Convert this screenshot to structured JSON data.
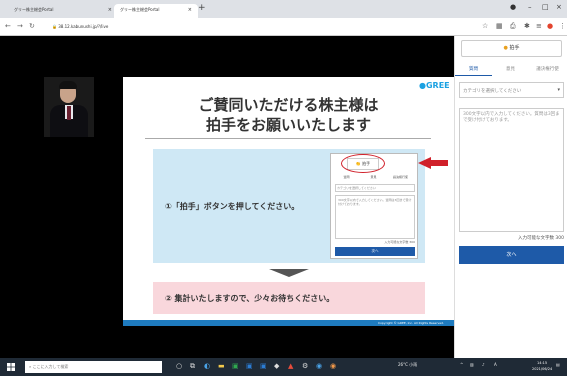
{
  "browser": {
    "tabs": [
      {
        "label": "グリー株主総会Portal"
      },
      {
        "label": "グリー株主総会Portal"
      }
    ],
    "url": "38.12.kabunushi.jp/?/live",
    "icons": [
      "back-icon",
      "forward-icon",
      "reload-icon",
      "lock-icon",
      "star-icon",
      "extension-icon",
      "menu-icon"
    ]
  },
  "slide": {
    "brand": "GREE",
    "title_line1": "ご賛同いただける株主様は",
    "title_line2": "拍手をお願いいたします",
    "step1": "①「拍手」ボタンを押してください。",
    "step2": "② 集計いたしますので、少々お待ちください。",
    "copyright": "Copyright © GREE, Inc. All Rights Reserved.",
    "mini": {
      "clap": "拍手",
      "tabs": [
        "質問",
        "意見",
        "議決権行使"
      ],
      "select": "カテゴリを選択してください",
      "textarea": "300文字以内で入力してください。質問は3回まで受け付けております。",
      "count": "入力可能な文字数 300",
      "next": "次へ"
    }
  },
  "panel": {
    "clap_label": "拍手",
    "tabs": [
      "質問",
      "意見",
      "議決権行使"
    ],
    "category_placeholder": "カテゴリを選択してください",
    "textarea_placeholder": "300文字以内で入力してください。質問は3回まで受け付けております。",
    "char_count": "入力可能な文字数 300",
    "next_label": "次へ"
  },
  "taskbar": {
    "search_placeholder": "ここに入力して検索",
    "weather": "26°C 小雨",
    "time": "14:15",
    "date": "2021/06/24"
  },
  "colors": {
    "accent_blue": "#1e5aa8",
    "step1_bg": "#cfe8f5",
    "step2_bg": "#f9d7dc",
    "arrow_red": "#d0202a",
    "gree_blue": "#1ba1e2"
  }
}
